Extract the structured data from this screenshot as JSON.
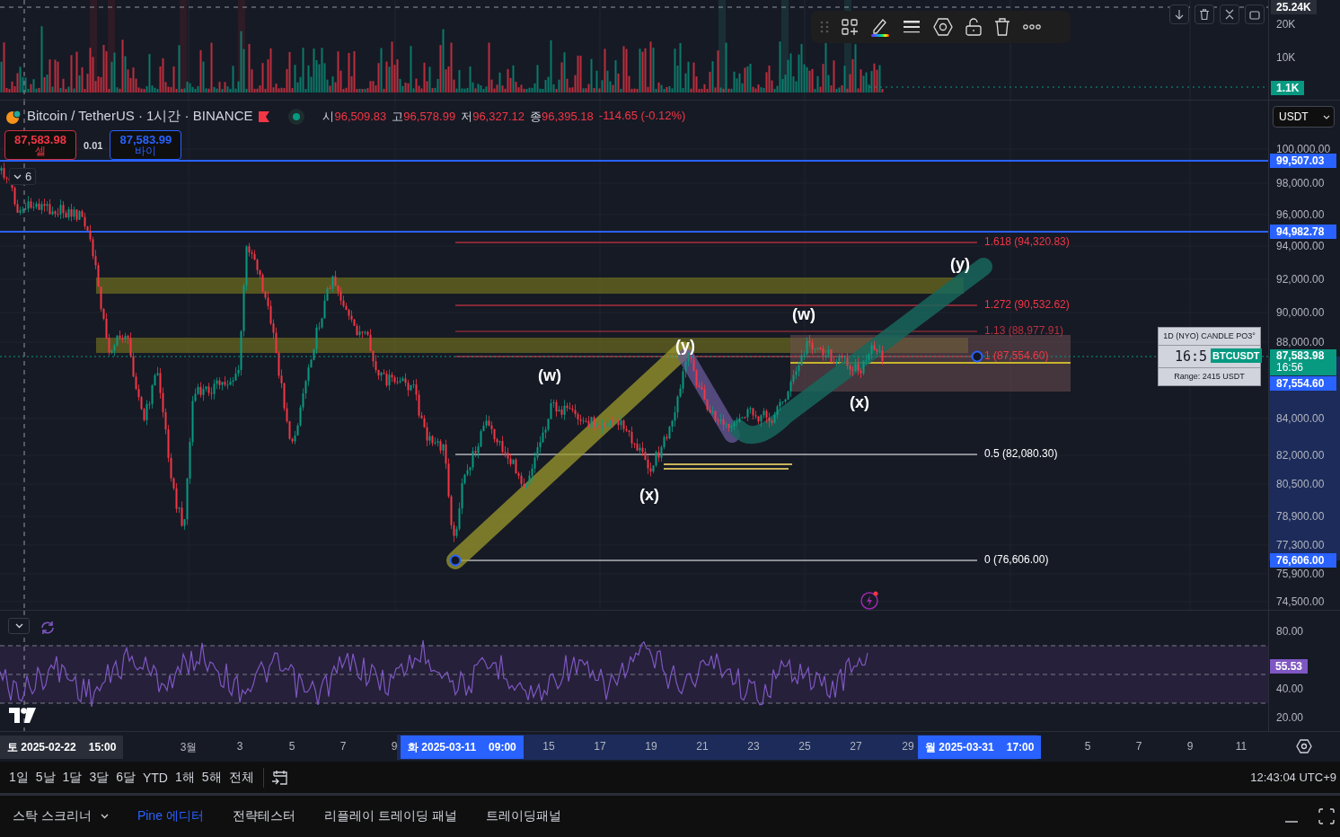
{
  "volume_pane": {
    "max_label": "25.24K",
    "axis_ticks": [
      "20K",
      "10K"
    ],
    "current_volume": "1.1K"
  },
  "symbol": {
    "title": "Bitcoin / TetherUS · 1시간 · BINANCE"
  },
  "ohlc": [
    {
      "label": "시",
      "value": "96,509.83"
    },
    {
      "label": "고",
      "value": "96,578.99"
    },
    {
      "label": "저",
      "value": "96,327.12"
    },
    {
      "label": "종",
      "value": "96,395.18"
    }
  ],
  "change": "-114.65 (-0.12%)",
  "trade": {
    "sell_price": "87,583.98",
    "sell_label": "셀",
    "spread": "0.01",
    "buy_price": "87,583.99",
    "buy_label": "바이"
  },
  "indicators_count": "6",
  "currency": "USDT",
  "price_axis": {
    "ticks": [
      "100,000.00",
      "98,000.00",
      "96,000.00",
      "94,000.00",
      "92,000.00",
      "90,000.00",
      "88,000.00",
      "84,000.00",
      "82,000.00",
      "80,500.00",
      "78,900.00",
      "77,300.00",
      "75,900.00",
      "74,500.00"
    ]
  },
  "price_labels": [
    {
      "kind": "line",
      "text": "99,507.03"
    },
    {
      "kind": "line",
      "text": "94,982.78"
    },
    {
      "kind": "last",
      "text": "87,583.98",
      "countdown": "16:56"
    },
    {
      "kind": "line",
      "text": "87,554.60"
    },
    {
      "kind": "line",
      "text": "76,606.00"
    }
  ],
  "fib_levels": [
    {
      "label": "1.618 (94,320.83)",
      "color": "#f23645"
    },
    {
      "label": "1.272 (90,532.62)",
      "color": "#f23645"
    },
    {
      "label": "1.13 (88,977.91)",
      "color": "#b8323f"
    },
    {
      "label": "1 (87,554.60)",
      "color": "#f23645"
    },
    {
      "label": "0.5 (82,080.30)",
      "color": "#ffffff"
    },
    {
      "label": "0 (76,606.00)",
      "color": "#ffffff"
    }
  ],
  "wave_labels": [
    "(y)",
    "(w)",
    "(y)",
    "(w)",
    "(x)",
    "(x)"
  ],
  "candle_info": {
    "title": "1D (NYO) CANDLE PO3°",
    "timer": "16:5",
    "symbol_tag": "BTCUSDT",
    "range": "Range: 2415 USDT"
  },
  "rsi": {
    "axis_ticks": [
      "80.00",
      "40.00",
      "20.00"
    ],
    "value": "55.53"
  },
  "time_axis": {
    "cursor": {
      "day": "토 2025-02-22",
      "time": "15:00"
    },
    "ticks": [
      "3월",
      "3",
      "5",
      "7",
      "9",
      "15",
      "17",
      "19",
      "21",
      "23",
      "25",
      "27",
      "29",
      "5",
      "7",
      "9",
      "11"
    ],
    "range_start": {
      "day": "화 2025-03-11",
      "time": "09:00"
    },
    "range_end": {
      "day": "월 2025-03-31",
      "time": "17:00"
    }
  },
  "range_buttons": [
    "1일",
    "5날",
    "1달",
    "3달",
    "6달",
    "YTD",
    "1해",
    "5해",
    "전체"
  ],
  "clock": "12:43:04 UTC+9",
  "bottom_tabs": [
    {
      "label": "스탁 스크리너",
      "kind": "dropdown",
      "selected": false
    },
    {
      "label": "Pine 에디터",
      "kind": "plain",
      "selected": true
    },
    {
      "label": "전략테스터",
      "kind": "plain",
      "selected": false
    },
    {
      "label": "리플레이 트레이딩 패널",
      "kind": "plain",
      "selected": false
    },
    {
      "label": "트레이딩패널",
      "kind": "plain",
      "selected": false
    }
  ]
}
